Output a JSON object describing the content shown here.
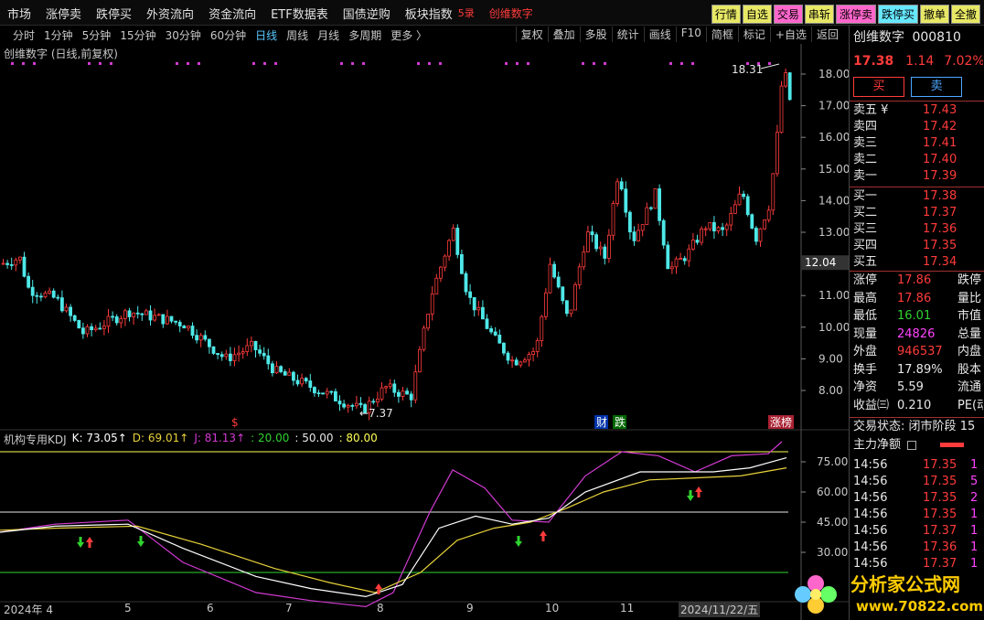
{
  "topmenu": [
    "市场",
    "涨停卖",
    "跌停买",
    "外资流向",
    "资金流向",
    "ETF数据表",
    "国债逆购",
    "板块指数"
  ],
  "topmenu_extra": "5录",
  "stock_name_top": "创维数字",
  "right_buttons": [
    "行情",
    "自选",
    "交易",
    "串斩",
    "涨停卖",
    "跌停买",
    "撤单",
    "全撤"
  ],
  "periods": [
    "分时",
    "1分钟",
    "5分钟",
    "15分钟",
    "30分钟",
    "60分钟",
    "日线",
    "周线",
    "月线",
    "多周期",
    "更多 〉"
  ],
  "active_period": "日线",
  "tools": [
    "复权",
    "叠加",
    "多股",
    "统计",
    "画线",
    "F10",
    "简框",
    "标记",
    "+自选",
    "返回"
  ],
  "chart_title": "创维数字 (日线,前复权)",
  "kdj": {
    "name": "机构专用KDJ",
    "k": "K: 73.05↑",
    "d": "D: 69.01↑",
    "j": "J: 81.13↑",
    "l1": ": 20.00",
    "l2": ": 50.00",
    "l3": ": 80.00"
  },
  "price_axis": [
    "18.00",
    "17.00",
    "16.00",
    "15.00",
    "14.00",
    "13.00",
    "12.00",
    "11.00",
    "10.00",
    "9.00",
    "8.00"
  ],
  "current_price_tag": "12.04",
  "kdj_axis": [
    "75.00",
    "60.00",
    "45.00",
    "30.00"
  ],
  "high_label": "18.31",
  "low_label": "7.37",
  "markers": {
    "cai": "财",
    "die": "跌",
    "zhangbang": "涨榜",
    "dollar": "$"
  },
  "xaxis": [
    "2024年 4",
    "5",
    "6",
    "7",
    "8",
    "9",
    "10",
    "11",
    "2024/11/22/五"
  ],
  "panel": {
    "name": "创维数字",
    "code": "000810",
    "price": "17.38",
    "change": "1.14",
    "pct": "7.02%",
    "buy_btn": "买",
    "sell_btn": "卖",
    "sells": [
      [
        "卖五 ¥",
        "17.43"
      ],
      [
        "卖四",
        "17.42"
      ],
      [
        "卖三",
        "17.41"
      ],
      [
        "卖二",
        "17.40"
      ],
      [
        "卖一",
        "17.39"
      ]
    ],
    "buys": [
      [
        "买一",
        "17.38"
      ],
      [
        "买二",
        "17.37"
      ],
      [
        "买三",
        "17.36"
      ],
      [
        "买四",
        "17.35"
      ],
      [
        "买五",
        "17.34"
      ]
    ],
    "stats": [
      [
        "涨停",
        "17.86",
        "跌停"
      ],
      [
        "最高",
        "17.86",
        "量比"
      ],
      [
        "最低",
        "16.01",
        "市值"
      ],
      [
        "现量",
        "24826",
        "总量"
      ],
      [
        "外盘",
        "946537",
        "内盘"
      ],
      [
        "换手",
        "17.89%",
        "股本"
      ],
      [
        "净资",
        "5.59",
        "流通"
      ],
      [
        "收益㈢",
        "0.210",
        "PE(动)"
      ]
    ],
    "trade_status_label": "交易状态:",
    "trade_status": "闭市阶段",
    "trade_status_num": "15",
    "main_flow": "主力净额",
    "ticks": [
      [
        "14:56",
        "17.35",
        "1"
      ],
      [
        "14:56",
        "17.35",
        "5"
      ],
      [
        "14:56",
        "17.35",
        "2"
      ],
      [
        "14:56",
        "17.35",
        "1"
      ],
      [
        "14:56",
        "17.37",
        "1"
      ],
      [
        "14:56",
        "17.36",
        "1"
      ],
      [
        "14:56",
        "17.37",
        "1"
      ]
    ]
  },
  "logo": {
    "text": "分析家公式网",
    "url": "www.70822.com"
  },
  "colors": {
    "up": "#ff3b3b",
    "down": "#4ee8e8",
    "k": "#ffffff",
    "d": "#e8d23a",
    "j": "#d23ad2"
  }
}
